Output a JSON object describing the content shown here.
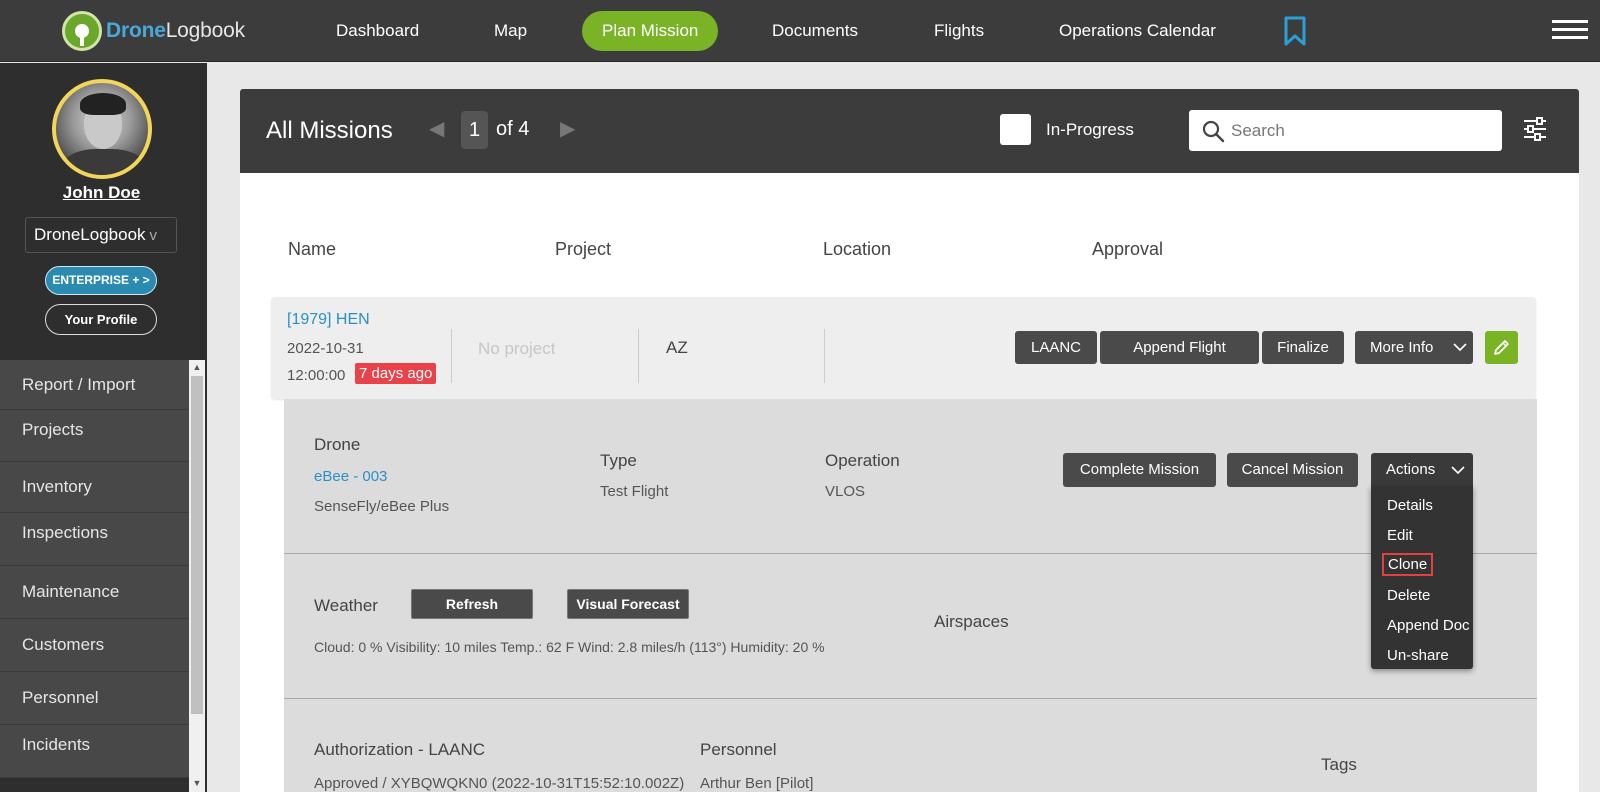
{
  "brand": {
    "part1": "Drone",
    "part2": "Logbook"
  },
  "nav": {
    "items": [
      "Dashboard",
      "Map",
      "Plan Mission",
      "Documents",
      "Flights",
      "Operations Calendar"
    ],
    "active": "Plan Mission"
  },
  "sidebar": {
    "user_name": "John Doe",
    "org_name": "DroneLogbook",
    "org_caret": "v",
    "enterprise_label": "ENTERPRISE + >",
    "profile_label": "Your Profile",
    "menu": [
      "Report / Import",
      "Projects",
      "Inventory",
      "Inspections",
      "Maintenance",
      "Customers",
      "Personnel",
      "Incidents"
    ]
  },
  "panel": {
    "title": "All Missions",
    "page_current": "1",
    "page_of": "of 4",
    "in_progress_label": "In-Progress",
    "search_placeholder": "Search"
  },
  "columns": [
    "Name",
    "Project",
    "Location",
    "Approval"
  ],
  "mission": {
    "name": "[1979] HEN",
    "date": "2022-10-31",
    "time": "12:00:00",
    "age_badge": "7 days ago",
    "project": "No project",
    "location": "AZ",
    "buttons": {
      "laanc": "LAANC",
      "append_flight": "Append Flight",
      "finalize": "Finalize",
      "more_info": "More Info"
    }
  },
  "details": {
    "drone_label": "Drone",
    "drone_link": "eBee - 003",
    "drone_model": "SenseFly/eBee Plus",
    "type_label": "Type",
    "type_value": "Test Flight",
    "operation_label": "Operation",
    "operation_value": "VLOS",
    "complete_btn": "Complete Mission",
    "cancel_btn": "Cancel Mission",
    "actions_btn": "Actions",
    "weather_label": "Weather",
    "refresh_btn": "Refresh",
    "forecast_btn": "Visual Forecast",
    "weather_info": "Cloud: 0 %  Visibility: 10 miles  Temp.: 62 F  Wind: 2.8 miles/h (113°)  Humidity: 20 %",
    "airspaces_label": "Airspaces",
    "auth_label": "Authorization - LAANC",
    "auth_value": "Approved / XYBQWQKN0 (2022-10-31T15:52:10.002Z)",
    "personnel_label": "Personnel",
    "personnel_value": "Arthur Ben [Pilot]",
    "tags_label": "Tags"
  },
  "actions_menu": [
    "Details",
    "Edit",
    "Clone",
    "Delete",
    "Append Doc",
    "Un-share"
  ],
  "actions_selected": "Clone",
  "colors": {
    "accent_green": "#7bb327",
    "link_blue": "#2a8fc9",
    "badge_red": "#e8424a",
    "topbar": "#3c3c3c"
  }
}
